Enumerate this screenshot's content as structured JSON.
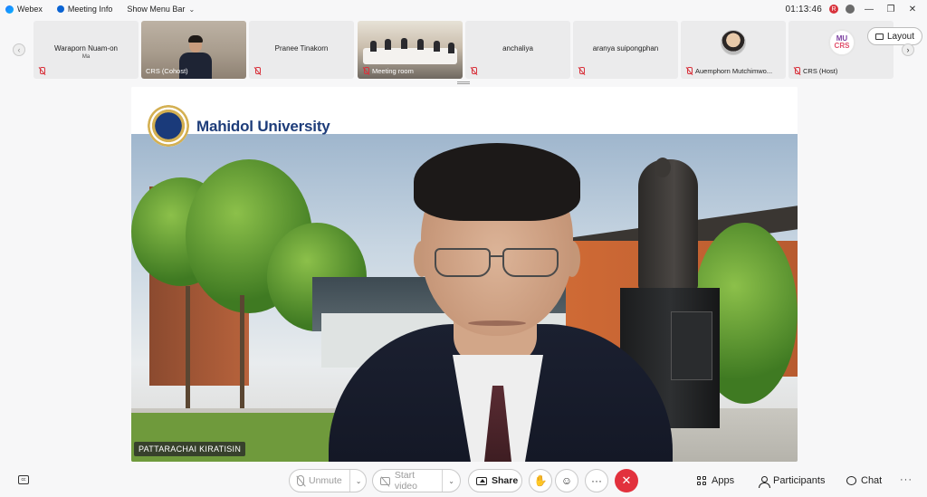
{
  "titlebar": {
    "app_name": "Webex",
    "meeting_info": "Meeting Info",
    "show_menu_bar": "Show Menu Bar",
    "clock": "01:13:46",
    "recording_indicator": "R",
    "lock_indicator": "🔒",
    "minimize": "—",
    "restore": "❐",
    "close": "✕"
  },
  "participants": [
    {
      "name": "Waraporn Nuam-on",
      "sub": "Ma",
      "label": "",
      "muted": true,
      "kind": "name"
    },
    {
      "name": "",
      "label": "CRS (Cohost)",
      "muted": true,
      "kind": "video-office"
    },
    {
      "name": "Pranee Tinakorn",
      "label": "",
      "muted": true,
      "kind": "name"
    },
    {
      "name": "",
      "label": "Meeting room",
      "muted": true,
      "kind": "video-room"
    },
    {
      "name": "anchaliya",
      "label": "",
      "muted": true,
      "kind": "name"
    },
    {
      "name": "aranya suipongphan",
      "label": "",
      "muted": true,
      "kind": "name"
    },
    {
      "name": "",
      "label": "Auemphorn Mutchimwo...",
      "muted": true,
      "kind": "avatar"
    },
    {
      "name": "",
      "label": "CRS (Host)",
      "muted": true,
      "kind": "logo"
    }
  ],
  "crs_logo": {
    "line1": "MU",
    "line2": "CRS"
  },
  "strip": {
    "prev_arrow": "‹",
    "next_arrow": "›"
  },
  "layout_button": "Layout",
  "main_video": {
    "banner_text": "Mahidol University",
    "speaker_name": "PATTARACHAI KIRATISIN"
  },
  "toolbar": {
    "unmute": "Unmute",
    "start_video": "Start video",
    "share": "Share",
    "raise_hand_icon": "✋",
    "reactions_icon": "☺",
    "more_icon": "···",
    "end_icon": "✕",
    "apps": "Apps",
    "participants": "Participants",
    "chat": "Chat",
    "overflow": "···",
    "captions_icon": "cc",
    "chevron": "⌄"
  }
}
